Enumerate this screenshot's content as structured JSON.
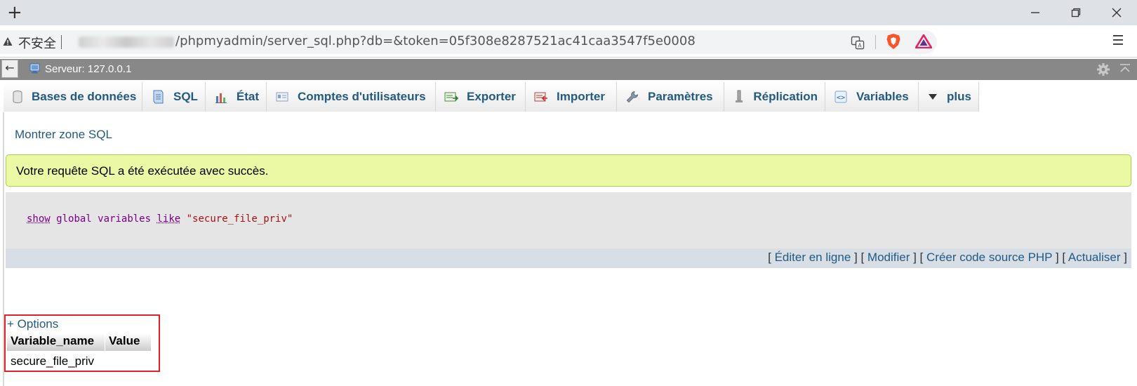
{
  "browser": {
    "new_tab_label": "+",
    "insecure_label": "不安全",
    "url": "/phpmyadmin/server_sql.php?db=&token=05f308e8287521ac41caa3547f5e0008"
  },
  "server_bar": {
    "back_label": "←",
    "server_label": "Serveur: 127.0.0.1"
  },
  "tabs": [
    {
      "label": "Bases de données",
      "icon": "database-icon"
    },
    {
      "label": "SQL",
      "icon": "sql-icon"
    },
    {
      "label": "État",
      "icon": "status-icon"
    },
    {
      "label": "Comptes d'utilisateurs",
      "icon": "users-icon"
    },
    {
      "label": "Exporter",
      "icon": "export-icon"
    },
    {
      "label": "Importer",
      "icon": "import-icon"
    },
    {
      "label": "Paramètres",
      "icon": "wrench-icon"
    },
    {
      "label": "Réplication",
      "icon": "replication-icon"
    },
    {
      "label": "Variables",
      "icon": "variables-icon"
    },
    {
      "label": "plus",
      "icon": "triangle-down-icon"
    }
  ],
  "content": {
    "show_sql_link": "Montrer zone SQL",
    "success_message": "Votre requête SQL a été exécutée avec succès.",
    "sql": {
      "kw_show": "show",
      "kw_global": "global",
      "kw_variables": "variables",
      "kw_like": "like",
      "string": "\"secure_file_priv\""
    },
    "actions": {
      "inline_edit": "Éditer en ligne",
      "edit": "Modifier",
      "php_code": "Créer code source PHP",
      "refresh": "Actualiser"
    }
  },
  "result": {
    "options_label": "+ Options",
    "columns": [
      "Variable_name",
      "Value"
    ],
    "rows": [
      [
        "secure_file_priv",
        ""
      ]
    ]
  },
  "colors": {
    "link": "#235a81",
    "success_bg": "#ebf8a4",
    "highlight_border": "#e3202a"
  }
}
